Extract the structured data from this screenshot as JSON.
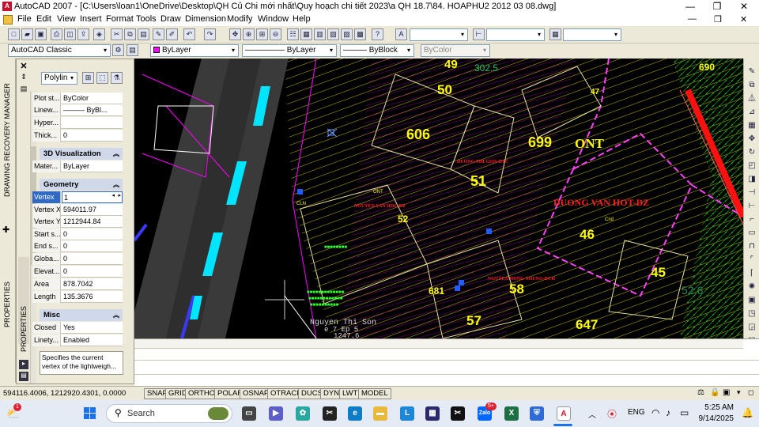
{
  "window": {
    "title": "AutoCAD 2007 - [C:\\Users\\loan1\\OneDrive\\Desktop\\QH Củ Chi mới nhất\\Quy hoạch chi tiết 2023\\a QH 18.7\\84. HOAPHU2 2012 03 08.dwg]",
    "app_badge": "A"
  },
  "menu": [
    "File",
    "Edit",
    "View",
    "Insert",
    "Format",
    "Tools",
    "Draw",
    "Dimension",
    "Modify",
    "Window",
    "Help"
  ],
  "toolbar2": {
    "workspace": "AutoCAD Classic",
    "color": "ByLayer",
    "linetype": "ByLayer",
    "lineweight": "ByBlock",
    "plotstyle": "ByColor"
  },
  "left_tabs": {
    "drawing_recovery": "DRAWING RECOVERY MANAGER",
    "properties": "PROPERTIES",
    "properties_inner": "PROPERTIES"
  },
  "properties": {
    "object_type": "Polylin",
    "rows_top": [
      {
        "label": "Plot st...",
        "value": "ByColor"
      },
      {
        "label": "Linew...",
        "value": "——— ByBl..."
      },
      {
        "label": "Hyper...",
        "value": ""
      },
      {
        "label": "Thick...",
        "value": "0"
      }
    ],
    "sec_3d": "3D Visualization",
    "rows_3d": [
      {
        "label": "Mater...",
        "value": "ByLayer"
      }
    ],
    "sec_geometry": "Geometry",
    "rows_geometry": [
      {
        "label": "Vertex",
        "value": "1"
      },
      {
        "label": "Vertex X",
        "value": "594011.97"
      },
      {
        "label": "Vertex Y",
        "value": "1212944.84"
      },
      {
        "label": "Start s...",
        "value": "0"
      },
      {
        "label": "End s...",
        "value": "0"
      },
      {
        "label": "Globa...",
        "value": "0"
      },
      {
        "label": "Elevat...",
        "value": "0"
      },
      {
        "label": "Area",
        "value": "878.7042"
      },
      {
        "label": "Length",
        "value": "135.3676"
      }
    ],
    "sec_misc": "Misc",
    "rows_misc": [
      {
        "label": "Closed",
        "value": "Yes"
      },
      {
        "label": "Linety...",
        "value": "Enabled"
      }
    ],
    "description": "Specifies the current vertex of the lightweigh..."
  },
  "drawing": {
    "lot_numbers": [
      "49",
      "50",
      "606",
      "699",
      "ONT",
      "51",
      "52",
      "46",
      "45",
      "681",
      "58",
      "57",
      "647",
      "690",
      "302.5",
      "47",
      "52.6"
    ],
    "red_texts": [
      "DUONG VAN HOT-DZ",
      "DUONG THI GIOI-HTC",
      "NGUYEN VAN HOC-DZ",
      "NGUYEN HONG NHUNG-DCH"
    ],
    "white_texts": [
      "Nguyen Thi Son",
      "e 7 Ep 5",
      "1247.6"
    ],
    "small_labels": [
      "ONT",
      "CLN",
      "Cnd"
    ]
  },
  "statusbar": {
    "coords": "594116.4006, 1212920.4301, 0.0000",
    "toggles": [
      "SNAP",
      "GRID",
      "ORTHO",
      "POLAR",
      "OSNAP",
      "OTRACK",
      "DUCS",
      "DYN",
      "LWT",
      "MODEL"
    ]
  },
  "taskbar": {
    "search_placeholder": "Search",
    "language": "ENG",
    "time": "5:25 AM",
    "date": "9/14/2025",
    "notification_badge": "1",
    "zalo_badge": "5+"
  },
  "colors": {
    "canvas_bg": "#000000",
    "panel_bg": "#ece9d8",
    "section_bg": "#cfd9ea",
    "lot_number": "#ffff00",
    "magenta_lines": "#ff00ff",
    "red_text": "#ff2020",
    "cyan_blocks": "#00ffff"
  }
}
